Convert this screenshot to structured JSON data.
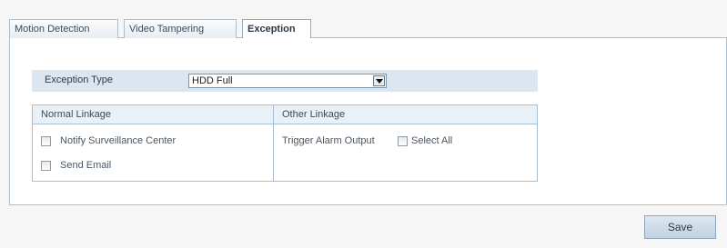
{
  "tabs": [
    {
      "label": "Motion Detection"
    },
    {
      "label": "Video Tampering"
    },
    {
      "label": "Exception"
    }
  ],
  "exception": {
    "type_label": "Exception Type",
    "type_value": "HDD Full"
  },
  "linkage": {
    "normal_header": "Normal Linkage",
    "other_header": "Other Linkage",
    "notify_label": "Notify Surveillance Center",
    "email_label": "Send Email",
    "trigger_label": "Trigger Alarm Output",
    "select_all_label": "Select All"
  },
  "save_label": "Save"
}
